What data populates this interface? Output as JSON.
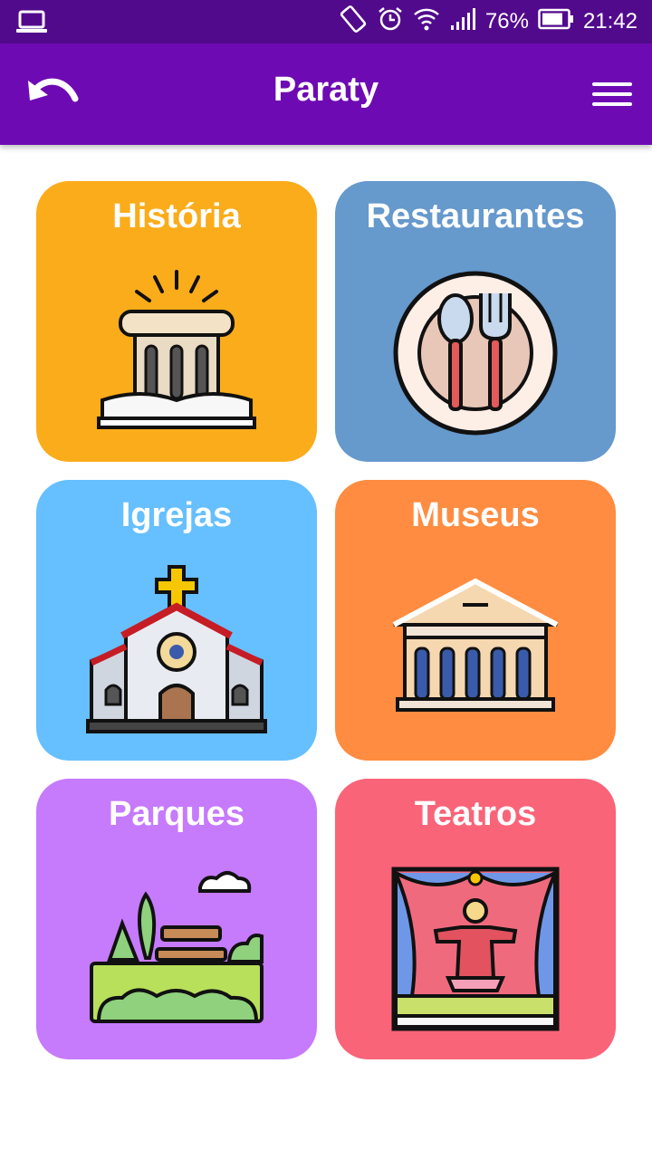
{
  "status_bar": {
    "battery_percent": "76%",
    "time": "21:42",
    "icons": [
      "laptop-icon",
      "rotate-icon",
      "alarm-icon",
      "wifi-icon",
      "signal-icon",
      "battery-icon"
    ]
  },
  "app_bar": {
    "title": "Paraty",
    "back_icon": "undo-arrow-icon",
    "menu_icon": "hamburger-menu-icon"
  },
  "categories": [
    {
      "label": "História",
      "color": "#fbac1b",
      "icon": "column-book-icon"
    },
    {
      "label": "Restaurantes",
      "color": "#6699cc",
      "icon": "plate-cutlery-icon"
    },
    {
      "label": "Igrejas",
      "color": "#66bfff",
      "icon": "church-icon"
    },
    {
      "label": "Museus",
      "color": "#ff8c40",
      "icon": "museum-building-icon"
    },
    {
      "label": "Parques",
      "color": "#c67afc",
      "icon": "park-bench-icon"
    },
    {
      "label": "Teatros",
      "color": "#fa6478",
      "icon": "theater-stage-icon"
    }
  ],
  "colors": {
    "status_bar": "#520a8c",
    "app_bar": "#6e0ab3"
  }
}
